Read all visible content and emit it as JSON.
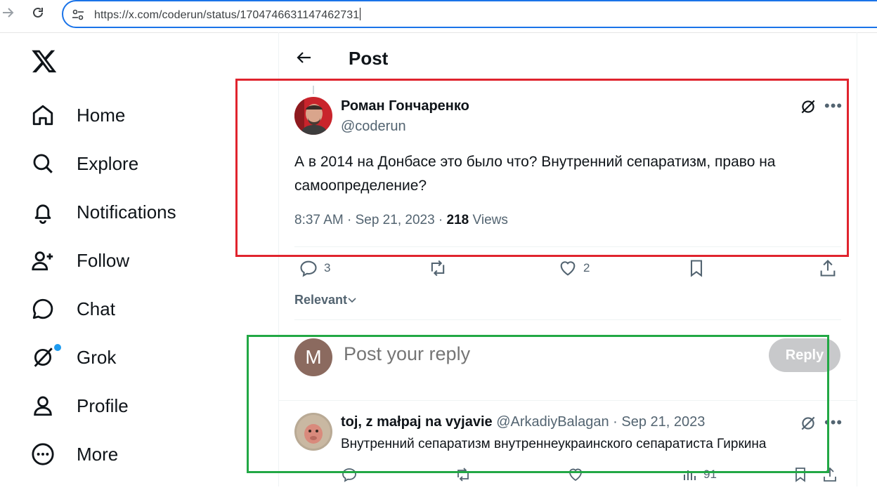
{
  "browser": {
    "url": "https://x.com/coderun/status/1704746631147462731",
    "back_icon": "arrow-right-icon",
    "reload_icon": "reload-icon"
  },
  "nav": {
    "items": [
      {
        "label": "Home",
        "icon": "home-icon"
      },
      {
        "label": "Explore",
        "icon": "search-icon"
      },
      {
        "label": "Notifications",
        "icon": "bell-icon"
      },
      {
        "label": "Follow",
        "icon": "add-user-icon"
      },
      {
        "label": "Chat",
        "icon": "chat-icon"
      },
      {
        "label": "Grok",
        "icon": "grok-icon"
      },
      {
        "label": "Profile",
        "icon": "profile-icon"
      },
      {
        "label": "More",
        "icon": "more-circle-icon"
      }
    ]
  },
  "header": {
    "title": "Post"
  },
  "post": {
    "author_name": "Роман Гончаренко",
    "handle": "@coderun",
    "text": "А в 2014 на Донбасе это было что? Внутренний сепаратизм, право на самоопределение?",
    "time": "8:37 AM · Sep 21, 2023 · ",
    "views_count": "218",
    "views_label": " Views",
    "replies": "3",
    "likes": "2"
  },
  "sort": {
    "label": "Relevant"
  },
  "reply_box": {
    "avatar_letter": "M",
    "placeholder": "Post your reply",
    "button": "Reply"
  },
  "comment": {
    "name": "toj, z małpaj na vyjavie",
    "handle_date": " @ArkadiyBalagan · Sep 21, 2023",
    "text": "Внутренний сепаратизм внутреннеукраинского сепаратиста Гиркина",
    "views": "91"
  },
  "colors": {
    "annotation_red": "#e0242e",
    "annotation_green": "#22a845",
    "accent_blue": "#1d9bf0",
    "secondary_text": "#536471"
  }
}
